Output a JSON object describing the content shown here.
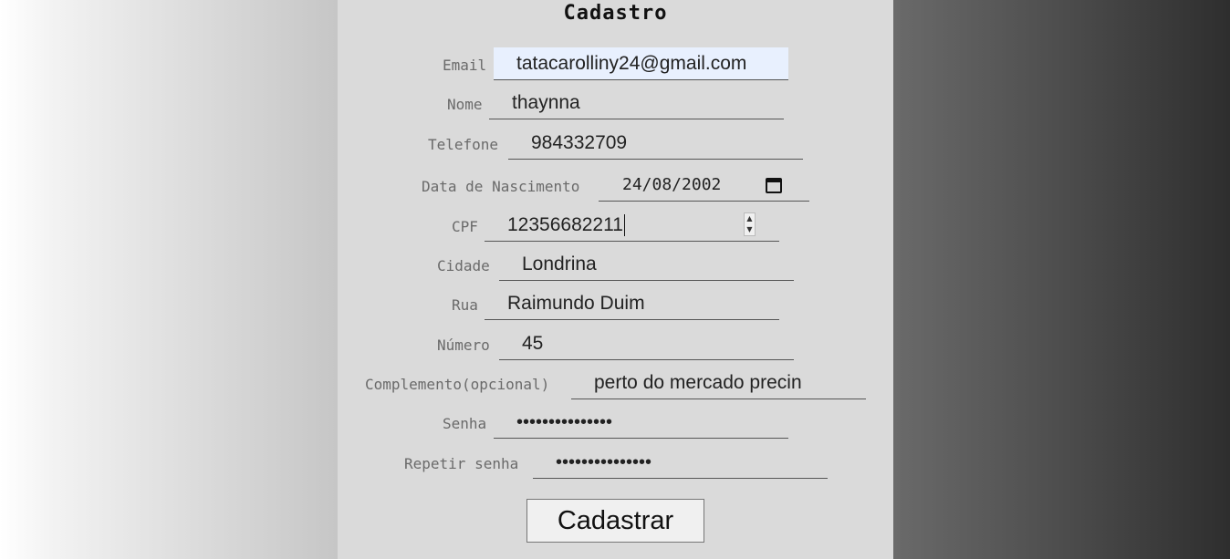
{
  "form": {
    "title": "Cadastro",
    "fields": [
      {
        "label": "Email",
        "value": "tatacarolliny24@gmail.com"
      },
      {
        "label": "Nome",
        "value": "thaynna"
      },
      {
        "label": "Telefone",
        "value": "984332709"
      },
      {
        "label": "Data de Nascimento",
        "value": "24/08/2002"
      },
      {
        "label": "CPF",
        "value": "12356682211"
      },
      {
        "label": "Cidade",
        "value": "Londrina"
      },
      {
        "label": "Rua",
        "value": "Raimundo Duim"
      },
      {
        "label": "Número",
        "value": "45"
      },
      {
        "label": "Complemento(opcional)",
        "value": "perto do mercado precin"
      },
      {
        "label": "Senha",
        "value": "•••••••••••••••"
      },
      {
        "label": "Repetir senha",
        "value": "•••••••••••••••"
      }
    ],
    "submit_label": "Cadastrar"
  },
  "colors": {
    "center_bg": "#dadada",
    "autofill_bg": "#e8f0fe",
    "left_gradient": [
      "#ffffff",
      "#c6c6c6"
    ],
    "right_gradient": [
      "#6a6a6a",
      "#2e2e2e"
    ]
  },
  "icons": {
    "date_picker": "calendar-icon",
    "number_spinner": "spinner-arrows"
  }
}
